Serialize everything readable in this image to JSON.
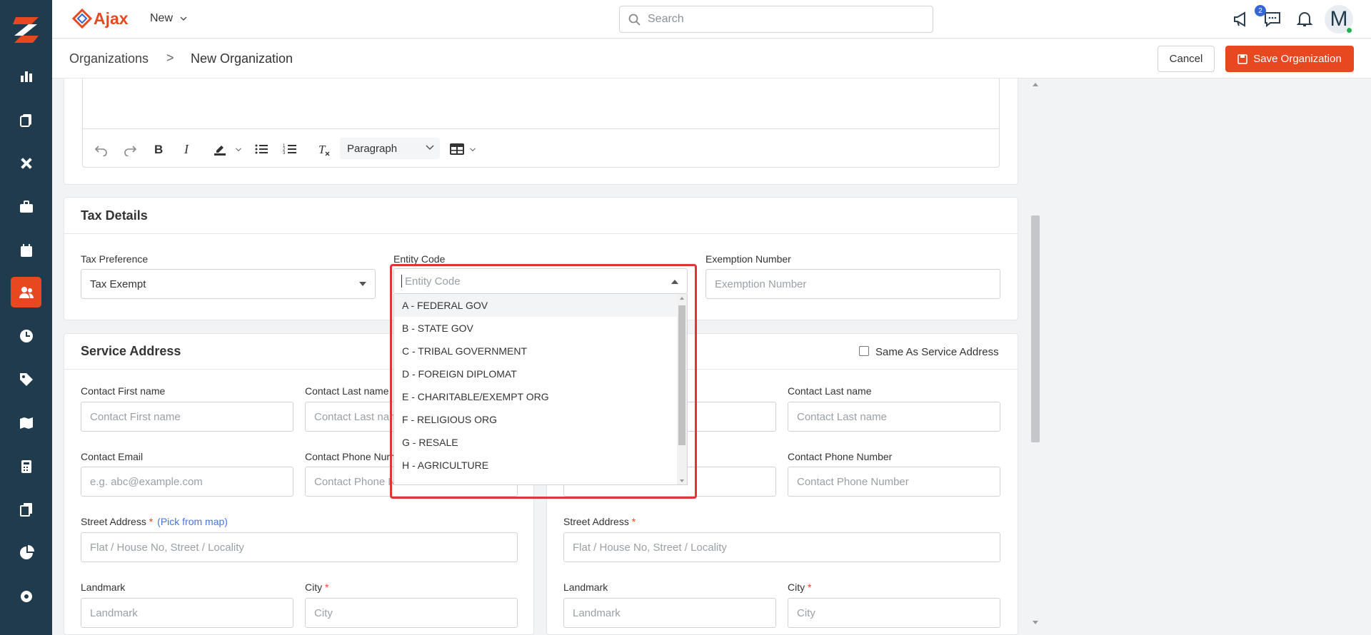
{
  "app": {
    "name": "Ajax",
    "new_menu": "New"
  },
  "search": {
    "placeholder": "Search"
  },
  "notifications": {
    "count": "2"
  },
  "user": {
    "initial": "M"
  },
  "breadcrumb": {
    "parent": "Organizations",
    "separator": ">",
    "current": "New Organization"
  },
  "actions": {
    "cancel": "Cancel",
    "save": "Save Organization"
  },
  "editor": {
    "paragraph_style": "Paragraph"
  },
  "tax": {
    "title": "Tax Details",
    "tax_preference_label": "Tax Preference",
    "tax_preference_value": "Tax Exempt",
    "entity_code_label": "Entity Code",
    "entity_code_placeholder": "Entity Code",
    "exemption_label": "Exemption Number",
    "exemption_placeholder": "Exemption Number"
  },
  "entity_options": [
    "A - FEDERAL GOV",
    "B - STATE GOV",
    "C - TRIBAL GOVERNMENT",
    "D - FOREIGN DIPLOMAT",
    "E - CHARITABLE/EXEMPT ORG",
    "F - RELIGIOUS ORG",
    "G - RESALE",
    "H - AGRICULTURE"
  ],
  "service_address": {
    "title": "Service Address",
    "contact_first_label": "Contact First name",
    "contact_first_placeholder": "Contact First name",
    "contact_last_label": "Contact Last name",
    "contact_last_placeholder": "Contact Last name",
    "email_label": "Contact Email",
    "email_placeholder": "e.g. abc@example.com",
    "phone_label": "Contact Phone Number",
    "phone_placeholder": "Contact Phone Number",
    "street_label": "Street Address",
    "pick_from_map": "(Pick from map)",
    "street_placeholder": "Flat / House No, Street / Locality",
    "landmark_label": "Landmark",
    "landmark_placeholder": "Landmark",
    "city_label": "City",
    "city_placeholder": "City"
  },
  "billing_address": {
    "same_as_label": "Same As Service Address",
    "contact_last_label": "Contact Last name",
    "contact_last_placeholder": "Contact Last name",
    "phone_label": "Contact Phone Number",
    "phone_placeholder": "Contact Phone Number",
    "street_label": "Street Address",
    "street_placeholder": "Flat / House No, Street / Locality",
    "landmark_label": "Landmark",
    "landmark_placeholder": "Landmark",
    "city_label": "City",
    "city_placeholder": "City"
  },
  "colors": {
    "accent": "#e8481f",
    "nav": "#1f3b4d",
    "highlight": "#e0333a"
  }
}
